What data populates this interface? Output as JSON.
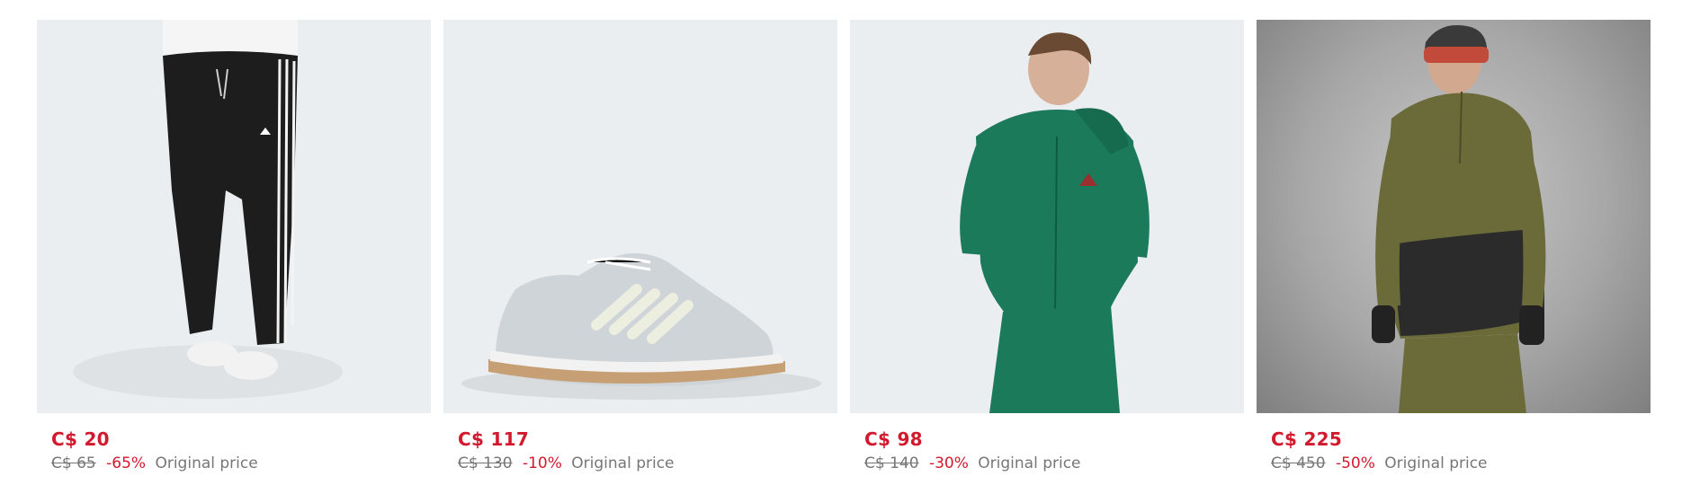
{
  "products": [
    {
      "price": "C$ 20",
      "original_price": "C$ 65",
      "discount": "-65%",
      "original_label": "Original price",
      "image_icon": "track-pants-icon",
      "bg": "#ebeef0"
    },
    {
      "price": "C$ 117",
      "original_price": "C$ 130",
      "discount": "-10%",
      "original_label": "Original price",
      "image_icon": "sneaker-icon",
      "bg": "#ebeef0"
    },
    {
      "price": "C$ 98",
      "original_price": "C$ 140",
      "discount": "-30%",
      "original_label": "Original price",
      "image_icon": "hoodie-model-icon",
      "bg": "#ebeef0"
    },
    {
      "price": "C$ 225",
      "original_price": "C$ 450",
      "discount": "-50%",
      "original_label": "Original price",
      "image_icon": "snow-jacket-model-icon",
      "bg": "#a7a7a7"
    }
  ],
  "colors": {
    "sale_red": "#d3192d",
    "muted_gray": "#767677"
  }
}
